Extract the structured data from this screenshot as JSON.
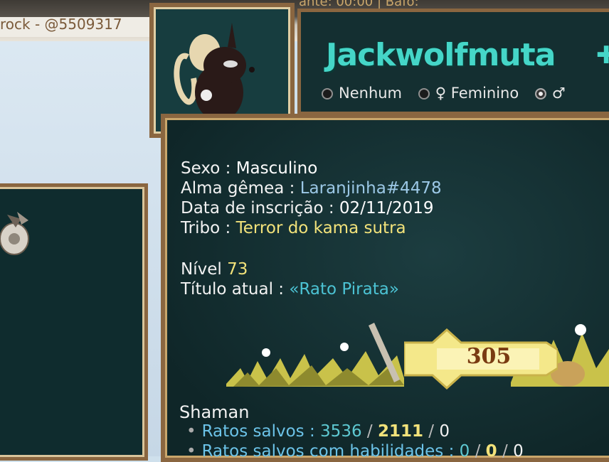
{
  "chat": {
    "text": "rock - @5509317",
    "top_right": "ante: 00:00  |  Bafo:"
  },
  "profile": {
    "username": "Jackwolfmuta",
    "gender_options": [
      {
        "label": "Nenhum",
        "selected": false
      },
      {
        "label": "♀ Feminino",
        "selected": false
      },
      {
        "label": "♂",
        "selected": true
      }
    ],
    "sexo_label": "Sexo : ",
    "sexo_value": "Masculino",
    "alma_label": "Alma gêmea : ",
    "alma_value": "Laranjinha#4478",
    "data_label": "Data de inscrição : ",
    "data_value": "02/11/2019",
    "tribo_label": "Tribo : ",
    "tribo_value": "Terror do kama sutra",
    "nivel_label": "Nível ",
    "nivel_value": "73",
    "titulo_label": "Título atual : ",
    "titulo_value": "«Rato Pirata»",
    "level_badge": "305"
  },
  "shaman": {
    "title": "Shaman",
    "rows": [
      {
        "label": "Ratos salvos : ",
        "a": "3536",
        "b": "2111",
        "c": "0"
      },
      {
        "label": "Ratos salvos com habilidades : ",
        "a": "0",
        "b": "0",
        "c": "0"
      }
    ]
  },
  "colors": {
    "username": "#45d6c8",
    "frame": "#8a6640",
    "panel": "#0f2628"
  }
}
